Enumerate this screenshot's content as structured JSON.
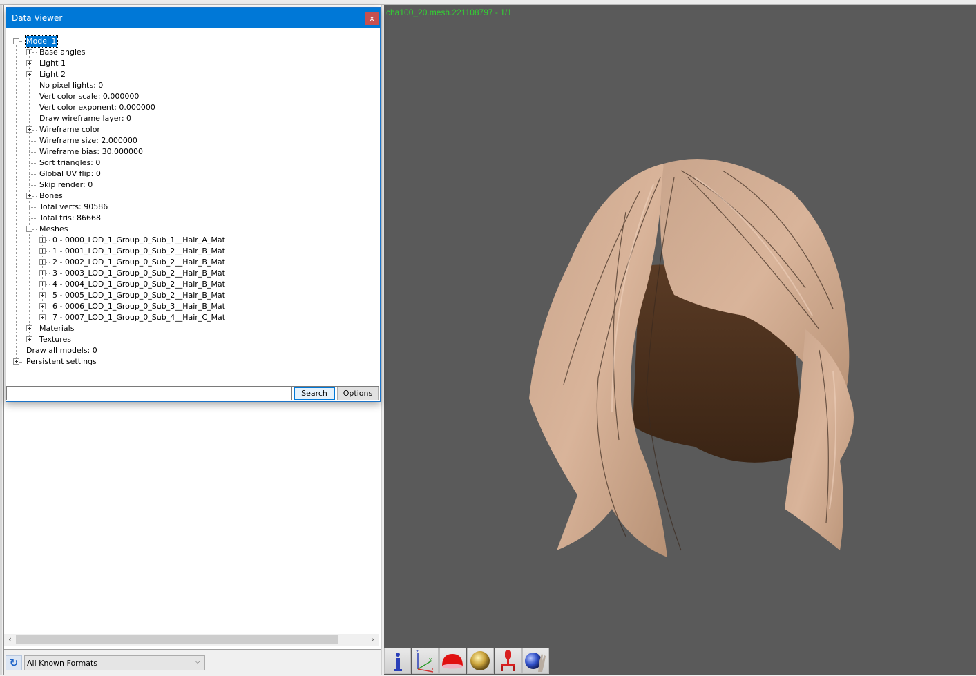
{
  "dialog": {
    "title": "Data Viewer",
    "close_label": "x",
    "tree": [
      {
        "label": "Model 1",
        "level": 0,
        "expander": "minus",
        "selected": true
      },
      {
        "label": "Base angles",
        "level": 1,
        "expander": "plus"
      },
      {
        "label": "Light 1",
        "level": 1,
        "expander": "plus"
      },
      {
        "label": "Light 2",
        "level": 1,
        "expander": "plus"
      },
      {
        "label": "No pixel lights: 0",
        "level": 1,
        "expander": "none"
      },
      {
        "label": "Vert color scale: 0.000000",
        "level": 1,
        "expander": "none"
      },
      {
        "label": "Vert color exponent: 0.000000",
        "level": 1,
        "expander": "none"
      },
      {
        "label": "Draw wireframe layer: 0",
        "level": 1,
        "expander": "none"
      },
      {
        "label": "Wireframe color",
        "level": 1,
        "expander": "plus"
      },
      {
        "label": "Wireframe size: 2.000000",
        "level": 1,
        "expander": "none"
      },
      {
        "label": "Wireframe bias: 30.000000",
        "level": 1,
        "expander": "none"
      },
      {
        "label": "Sort triangles: 0",
        "level": 1,
        "expander": "none"
      },
      {
        "label": "Global UV flip: 0",
        "level": 1,
        "expander": "none"
      },
      {
        "label": "Skip render: 0",
        "level": 1,
        "expander": "none"
      },
      {
        "label": "Bones",
        "level": 1,
        "expander": "plus"
      },
      {
        "label": "Total verts: 90586",
        "level": 1,
        "expander": "none"
      },
      {
        "label": "Total tris: 86668",
        "level": 1,
        "expander": "none"
      },
      {
        "label": "Meshes",
        "level": 1,
        "expander": "minus"
      },
      {
        "label": "0 - 0000_LOD_1_Group_0_Sub_1__Hair_A_Mat",
        "level": 2,
        "expander": "plus"
      },
      {
        "label": "1 - 0001_LOD_1_Group_0_Sub_2__Hair_B_Mat",
        "level": 2,
        "expander": "plus"
      },
      {
        "label": "2 - 0002_LOD_1_Group_0_Sub_2__Hair_B_Mat",
        "level": 2,
        "expander": "plus"
      },
      {
        "label": "3 - 0003_LOD_1_Group_0_Sub_2__Hair_B_Mat",
        "level": 2,
        "expander": "plus"
      },
      {
        "label": "4 - 0004_LOD_1_Group_0_Sub_2__Hair_B_Mat",
        "level": 2,
        "expander": "plus"
      },
      {
        "label": "5 - 0005_LOD_1_Group_0_Sub_2__Hair_B_Mat",
        "level": 2,
        "expander": "plus"
      },
      {
        "label": "6 - 0006_LOD_1_Group_0_Sub_3__Hair_B_Mat",
        "level": 2,
        "expander": "plus"
      },
      {
        "label": "7 - 0007_LOD_1_Group_0_Sub_4__Hair_C_Mat",
        "level": 2,
        "expander": "plus"
      },
      {
        "label": "Materials",
        "level": 1,
        "expander": "plus"
      },
      {
        "label": "Textures",
        "level": 1,
        "expander": "plus"
      },
      {
        "label": "Draw all models: 0",
        "level": 0,
        "expander": "none"
      },
      {
        "label": "Persistent settings",
        "level": 0,
        "expander": "plus"
      }
    ],
    "search": {
      "value": "",
      "placeholder": "",
      "search_label": "Search",
      "options_label": "Options"
    }
  },
  "left_pane": {
    "format_filter": "All Known Formats",
    "refresh_icon": "refresh-icon",
    "scroll_left": "‹",
    "scroll_right": "›",
    "chevron": "⌵"
  },
  "viewport": {
    "mesh_label": "cha100_20.mesh.221108797 - 1/1",
    "label_color": "#32d232",
    "background": "#5a5a5a",
    "toolbar": [
      {
        "name": "info-button",
        "icon": "info-icon"
      },
      {
        "name": "axes-button",
        "icon": "axes-icon"
      },
      {
        "name": "hemisphere-light-button",
        "icon": "hemisphere-icon"
      },
      {
        "name": "material-sphere-button",
        "icon": "sphere-icon"
      },
      {
        "name": "skeleton-button",
        "icon": "robot-icon"
      },
      {
        "name": "grab-sphere-button",
        "icon": "hand-sphere-icon"
      }
    ]
  }
}
